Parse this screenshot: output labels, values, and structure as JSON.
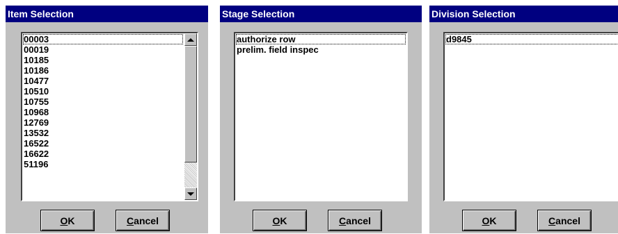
{
  "item_dialog": {
    "title": "Item Selection",
    "items": [
      "00003",
      "00019",
      "10185",
      "10186",
      "10477",
      "10510",
      "10755",
      "10968",
      "12769",
      "13532",
      "16522",
      "16622",
      "51196"
    ],
    "ok": {
      "mnemonic": "O",
      "rest": "K"
    },
    "cancel": {
      "mnemonic": "C",
      "rest": "ancel"
    }
  },
  "stage_dialog": {
    "title": "Stage Selection",
    "items": [
      "authorize row",
      "prelim. field inspec"
    ],
    "ok": {
      "mnemonic": "O",
      "rest": "K"
    },
    "cancel": {
      "mnemonic": "C",
      "rest": "ancel"
    }
  },
  "division_dialog": {
    "title": "Division Selection",
    "items": [
      "d9845"
    ],
    "ok": {
      "mnemonic": "O",
      "rest": "K"
    },
    "cancel": {
      "mnemonic": "C",
      "rest": "ancel"
    }
  },
  "icons": [
    "scroll-up-arrow-icon",
    "scroll-down-arrow-icon"
  ],
  "colors": {
    "titlebar": "#000080",
    "face": "#c0c0c0",
    "list_bg": "#ffffff"
  }
}
